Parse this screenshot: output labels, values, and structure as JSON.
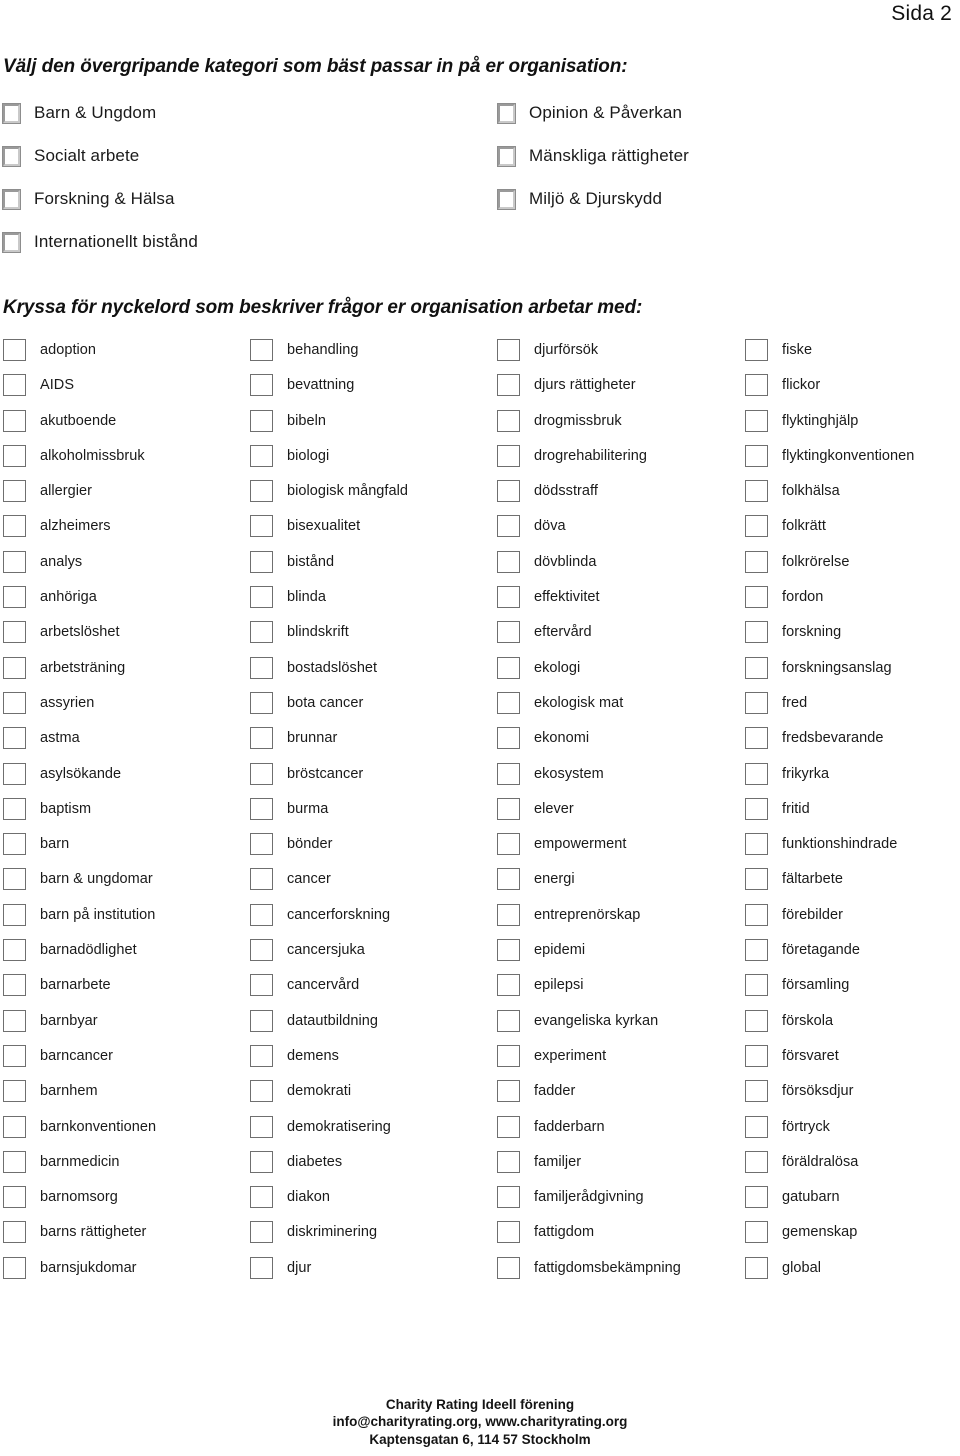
{
  "page_label": "Sida 2",
  "categories": {
    "heading": "Välj den övergripande kategori som bäst passar in på er organisation:",
    "left": [
      "Barn & Ungdom",
      "Socialt arbete",
      "Forskning & Hälsa",
      "Internationellt bistånd"
    ],
    "right": [
      "Opinion & Påverkan",
      "Mänskliga rättigheter",
      "Miljö & Djurskydd"
    ]
  },
  "keywords": {
    "heading": "Kryssa för nyckelord som beskriver frågor er organisation arbetar med:",
    "columns": [
      [
        "adoption",
        "AIDS",
        "akutboende",
        "alkoholmissbruk",
        "allergier",
        "alzheimers",
        "analys",
        "anhöriga",
        "arbetslöshet",
        "arbetsträning",
        "assyrien",
        "astma",
        "asylsökande",
        "baptism",
        "barn",
        "barn & ungdomar",
        "barn på institution",
        "barnadödlighet",
        "barnarbete",
        "barnbyar",
        "barncancer",
        "barnhem",
        "barnkonventionen",
        "barnmedicin",
        "barnomsorg",
        "barns rättigheter",
        "barnsjukdomar"
      ],
      [
        "behandling",
        "bevattning",
        "bibeln",
        "biologi",
        "biologisk mångfald",
        "bisexualitet",
        "bistånd",
        "blinda",
        "blindskrift",
        "bostadslöshet",
        "bota cancer",
        "brunnar",
        "bröstcancer",
        "burma",
        "bönder",
        "cancer",
        "cancerforskning",
        "cancersjuka",
        "cancervård",
        "datautbildning",
        "demens",
        "demokrati",
        "demokratisering",
        "diabetes",
        "diakon",
        "diskriminering",
        "djur"
      ],
      [
        "djurförsök",
        "djurs rättigheter",
        "drogmissbruk",
        "drogrehabilitering",
        "dödsstraff",
        "döva",
        "dövblinda",
        "effektivitet",
        "eftervård",
        "ekologi",
        "ekologisk mat",
        "ekonomi",
        "ekosystem",
        "elever",
        "empowerment",
        "energi",
        "entreprenörskap",
        "epidemi",
        "epilepsi",
        "evangeliska kyrkan",
        "experiment",
        "fadder",
        "fadderbarn",
        "familjer",
        "familjerådgivning",
        "fattigdom",
        "fattigdomsbekämpning"
      ],
      [
        "fiske",
        "flickor",
        "flyktinghjälp",
        "flyktingkonventionen",
        "folkhälsa",
        "folkrätt",
        "folkrörelse",
        "fordon",
        "forskning",
        "forskningsanslag",
        "fred",
        "fredsbevarande",
        "frikyrka",
        "fritid",
        "funktionshindrade",
        "fältarbete",
        "förebilder",
        "företagande",
        "församling",
        "förskola",
        "försvaret",
        "försöksdjur",
        "förtryck",
        "föräldralösa",
        "gatubarn",
        "gemenskap",
        "global"
      ]
    ]
  },
  "footer": {
    "line1": "Charity Rating Ideell förening",
    "line2": "info@charityrating.org, www.charityrating.org",
    "line3": "Kaptensgatan 6, 114 57 Stockholm"
  }
}
